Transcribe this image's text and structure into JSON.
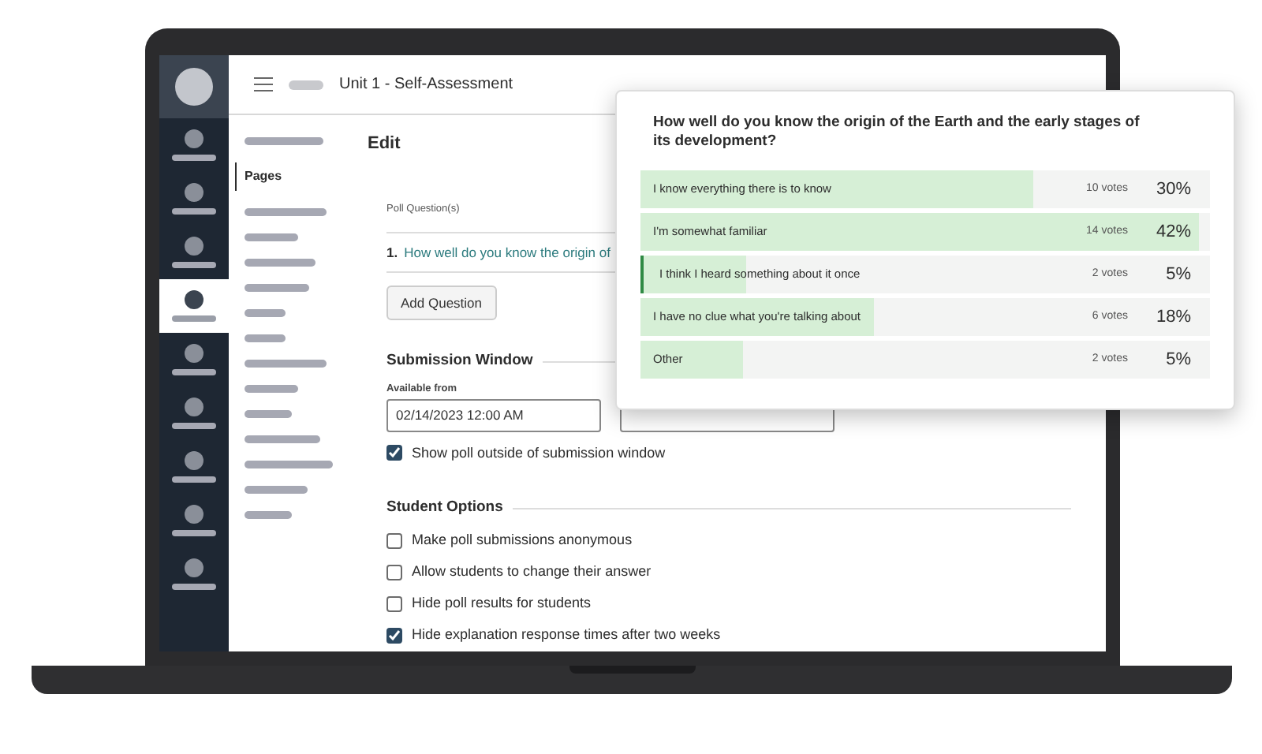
{
  "header": {
    "title": "Unit 1 - Self-Assessment"
  },
  "subnav": {
    "active_label": "Pages"
  },
  "editor": {
    "heading": "Edit",
    "questions_label": "Poll Question(s)",
    "questions": [
      {
        "number": "1.",
        "text": "How well do you know the origin of"
      }
    ],
    "add_button": "Add Question",
    "submission": {
      "heading": "Submission Window",
      "available_label": "Available from",
      "available_value": "02/14/2023 12:00 AM",
      "options": [
        {
          "label": "Show poll outside of submission window",
          "checked": true
        }
      ]
    },
    "student": {
      "heading": "Student Options",
      "options": [
        {
          "label": "Make poll submissions anonymous",
          "checked": false
        },
        {
          "label": "Allow students to change their answer",
          "checked": false
        },
        {
          "label": "Hide poll results for students",
          "checked": false
        },
        {
          "label": "Hide explanation response times after two weeks",
          "checked": true
        }
      ]
    }
  },
  "results": {
    "question": "How well do you know the origin of the Earth and the early stages of its development?",
    "answers": [
      {
        "text": "I know everything there is to know",
        "votes": "10 votes",
        "percent": "30%",
        "level": 0.69,
        "selected": false
      },
      {
        "text": "I'm somewhat familiar",
        "votes": "14 votes",
        "percent": "42%",
        "level": 0.98,
        "selected": false
      },
      {
        "text": "I think I heard something about it once",
        "votes": "2 votes",
        "percent": "5%",
        "level": 0.18,
        "selected": true
      },
      {
        "text": "I have no clue what you're talking about",
        "votes": "6 votes",
        "percent": "18%",
        "level": 0.41,
        "selected": false
      },
      {
        "text": "Other",
        "votes": "2 votes",
        "percent": "5%",
        "level": 0.18,
        "selected": false
      }
    ]
  }
}
